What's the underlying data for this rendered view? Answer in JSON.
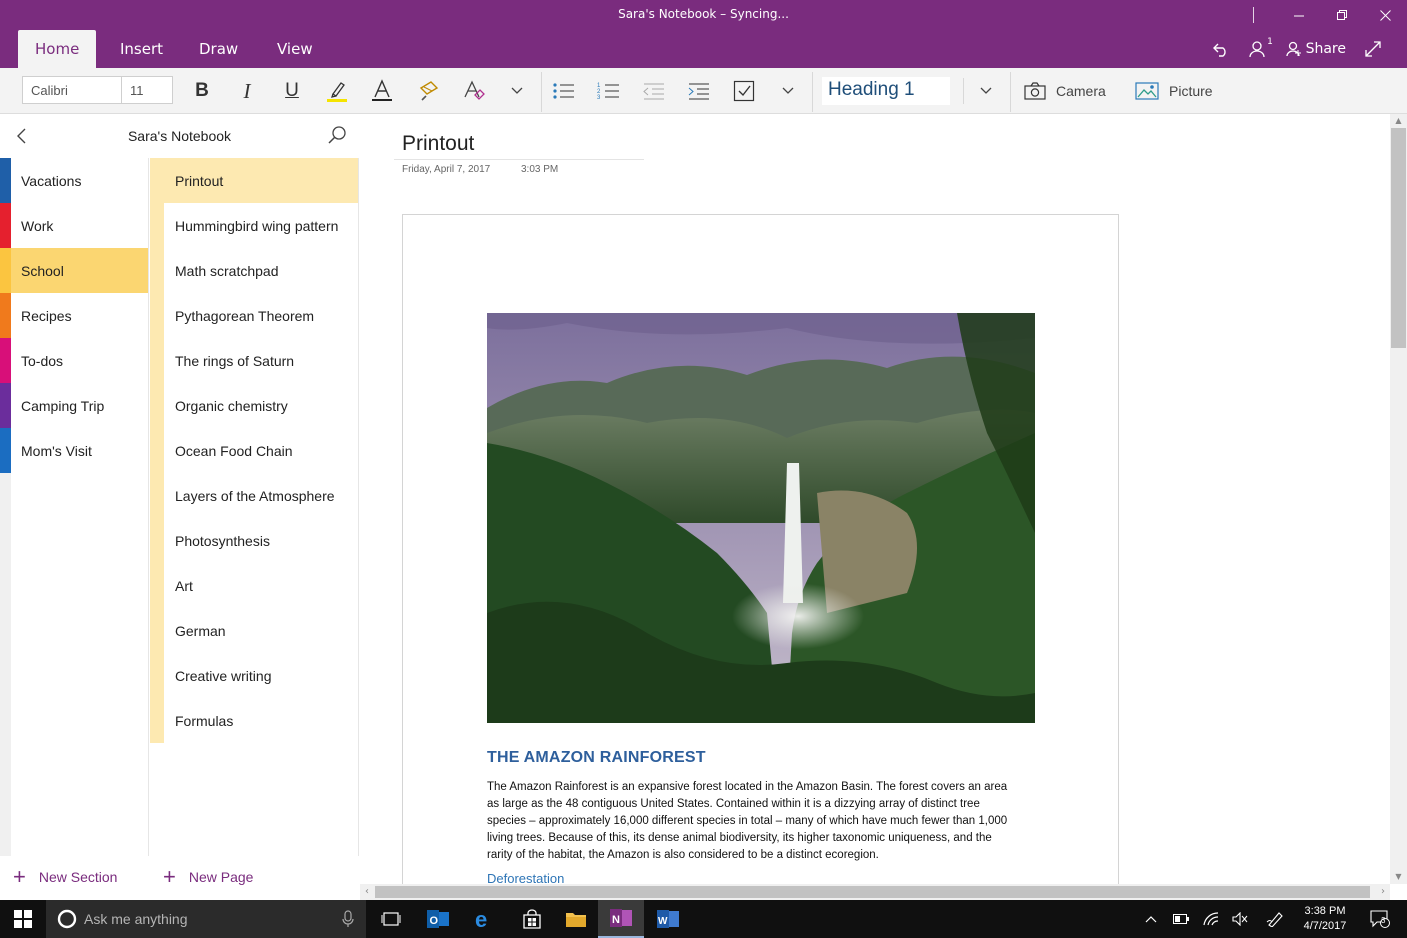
{
  "window": {
    "title": "Sara's Notebook – Syncing...",
    "minimize_icon": "minimize-icon",
    "restore_icon": "restore-icon",
    "close_icon": "close-icon"
  },
  "ribbon": {
    "tabs": [
      {
        "label": "Home",
        "active": true
      },
      {
        "label": "Insert",
        "active": false
      },
      {
        "label": "Draw",
        "active": false
      },
      {
        "label": "View",
        "active": false
      }
    ],
    "share_label": "Share",
    "people_badge": "1"
  },
  "toolbar": {
    "font_name": "Calibri",
    "font_size": "11",
    "style": "Heading 1",
    "camera_label": "Camera",
    "picture_label": "Picture",
    "highlight_color": "#f5e400",
    "font_color_underline": "#222222"
  },
  "notebook": {
    "name": "Sara's Notebook",
    "sections": [
      {
        "label": "Vacations",
        "color": "#1f5fa8",
        "active": false
      },
      {
        "label": "Work",
        "color": "#e5202e",
        "active": false
      },
      {
        "label": "School",
        "color": "#fbc540",
        "active": true
      },
      {
        "label": "Recipes",
        "color": "#f07a1c",
        "active": false
      },
      {
        "label": "To-dos",
        "color": "#d80f79",
        "active": false
      },
      {
        "label": "Camping Trip",
        "color": "#6b2d9c",
        "active": false
      },
      {
        "label": "Mom's Visit",
        "color": "#1b6dc1",
        "active": false
      }
    ],
    "pages": [
      {
        "label": "Printout",
        "active": true
      },
      {
        "label": "Hummingbird wing pattern",
        "active": false
      },
      {
        "label": "Math scratchpad",
        "active": false
      },
      {
        "label": "Pythagorean Theorem",
        "active": false
      },
      {
        "label": "The rings of Saturn",
        "active": false
      },
      {
        "label": "Organic chemistry",
        "active": false
      },
      {
        "label": "Ocean Food Chain",
        "active": false
      },
      {
        "label": "Layers of the Atmosphere",
        "active": false
      },
      {
        "label": "Photosynthesis",
        "active": false
      },
      {
        "label": "Art",
        "active": false
      },
      {
        "label": "German",
        "active": false
      },
      {
        "label": "Creative writing",
        "active": false
      },
      {
        "label": "Formulas",
        "active": false
      }
    ],
    "new_section_label": "New Section",
    "new_page_label": "New Page"
  },
  "page": {
    "title": "Printout",
    "date": "Friday, April 7, 2017",
    "time": "3:03 PM",
    "doc": {
      "heading": "THE AMAZON RAINFOREST",
      "body": "The Amazon Rainforest is an expansive forest located in the Amazon Basin.  The forest covers an area as large as the 48 contiguous United States. Contained within it is a dizzying array of distinct tree species – approximately 16,000 different species in total – many of which have much fewer than 1,000 living trees.  Because of this, its dense animal biodiversity, its higher taxonomic uniqueness, and the rarity of the habitat, the Amazon is also considered to be a distinct ecoregion.",
      "link": "Deforestation"
    }
  },
  "taskbar": {
    "search_placeholder": "Ask me anything",
    "time": "3:38 PM",
    "date": "4/7/2017",
    "notification_count": "3"
  },
  "colors": {
    "brand": "#7a2c7e",
    "page_highlight": "#fde9b1",
    "section_highlight": "#fbd671"
  }
}
